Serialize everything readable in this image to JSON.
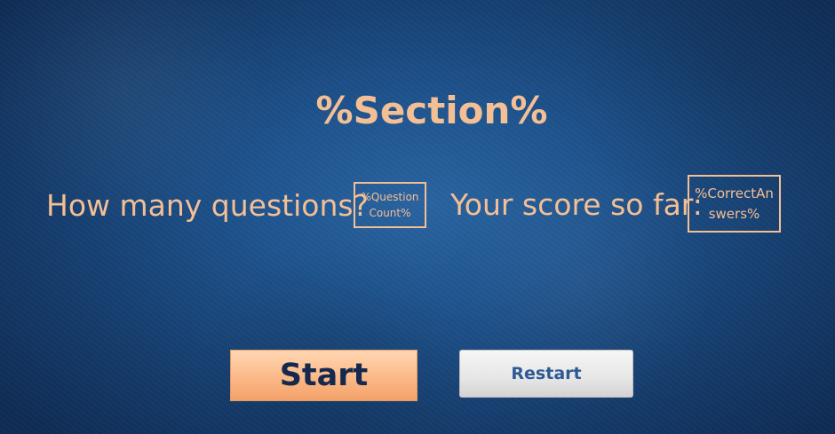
{
  "title": "%Section%",
  "questions": {
    "label": "How many questions?",
    "value": "%QuestionCount%"
  },
  "score": {
    "label": "Your score so far:",
    "value": "%CorrectAnswers%"
  },
  "buttons": {
    "start_label": "Start",
    "restart_label": "Restart"
  },
  "colors": {
    "accent_text": "#f4bf94",
    "background": "#1f5590",
    "start_button": "#fbb887",
    "restart_text": "#2e5a94"
  }
}
